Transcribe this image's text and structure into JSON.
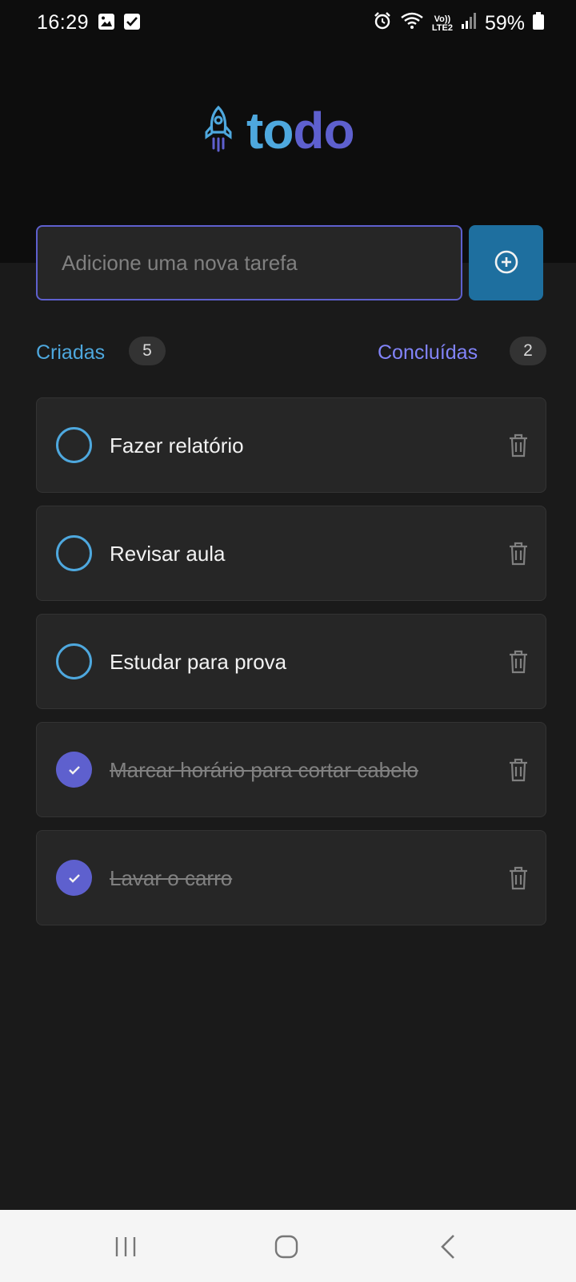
{
  "status_bar": {
    "time": "16:29",
    "battery": "59%",
    "network": "Vo)) LTE2"
  },
  "app": {
    "logo_part1": "to",
    "logo_part2": "do",
    "logo_icon": "rocket-icon"
  },
  "input": {
    "placeholder": "Adicione uma nova tarefa",
    "value": "",
    "add_icon": "plus-circle-icon"
  },
  "counters": {
    "created_label": "Criadas",
    "created_count": "5",
    "done_label": "Concluídas",
    "done_count": "2"
  },
  "tasks": [
    {
      "title": "Fazer relatório",
      "done": false
    },
    {
      "title": "Revisar aula",
      "done": false
    },
    {
      "title": "Estudar para prova",
      "done": false
    },
    {
      "title": "Marcar horário para cortar cabelo",
      "done": true
    },
    {
      "title": "Lavar o carro",
      "done": true
    }
  ],
  "colors": {
    "blue": "#4ea8de",
    "purple": "#5e60ce",
    "purple_light": "#8284fa",
    "button_blue": "#1e6f9f",
    "card": "#262626",
    "background": "#1a1a1a",
    "header": "#0d0d0d"
  }
}
